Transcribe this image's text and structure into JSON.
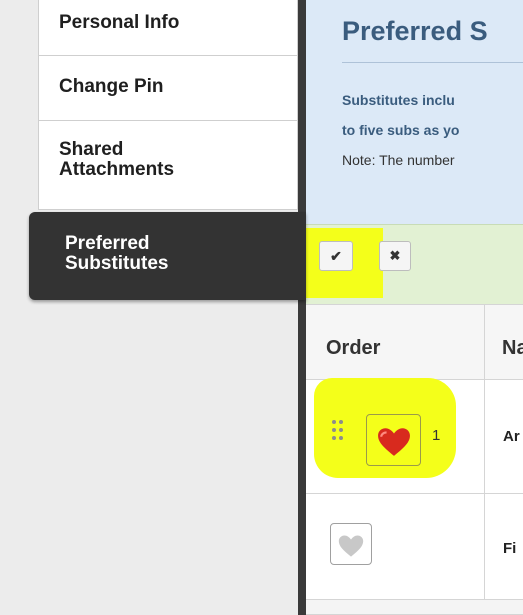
{
  "sidebar": {
    "items": [
      {
        "label": "Personal Info"
      },
      {
        "label": "Change Pin"
      },
      {
        "label": "Shared Attachments"
      },
      {
        "label": "Preferred Substitutes"
      }
    ]
  },
  "header": {
    "title": "Preferred S",
    "desc_line1": "Substitutes inclu",
    "desc_line2": "to five subs as yo",
    "desc_line3": "Note: The number"
  },
  "toolbar": {
    "accept_icon": "✔",
    "cancel_icon": "✖"
  },
  "table": {
    "headers": {
      "order": "Order",
      "name": "Na"
    },
    "rows": [
      {
        "rank": "1",
        "favorited": true,
        "name": "Ar"
      },
      {
        "rank": "",
        "favorited": false,
        "name": "Fi"
      }
    ]
  },
  "colors": {
    "highlight": "#f4ff1a",
    "active_tab_bg": "#333333",
    "header_bg": "#dce9f7",
    "toolbar_bg": "#e2f1d3",
    "heart_active": "#d82a1e",
    "heart_inactive": "#c8c8c8"
  },
  "icons": {
    "drag": "drag-handle-icon",
    "heart": "heart-icon",
    "check": "check-icon",
    "close": "close-icon"
  }
}
